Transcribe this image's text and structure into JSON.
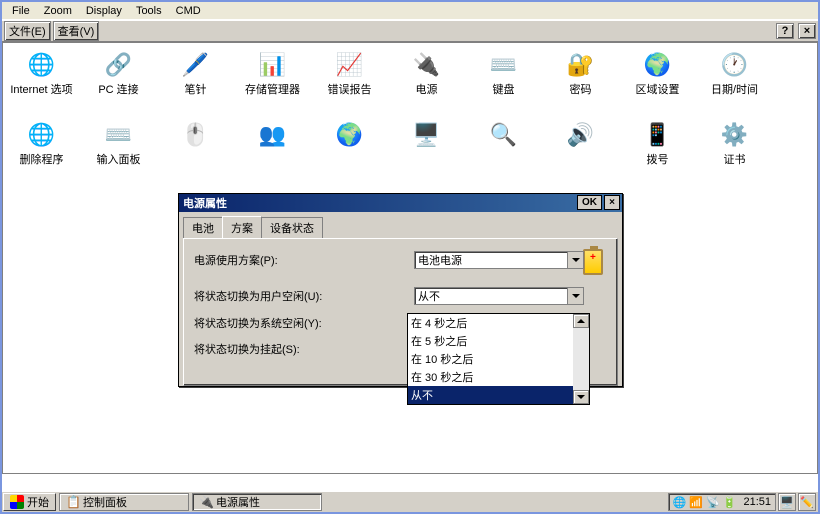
{
  "outer_menu": [
    "File",
    "Zoom",
    "Display",
    "Tools",
    "CMD"
  ],
  "inner_toolbar": {
    "file": "文件(E)",
    "view": "查看(V)",
    "help": "?",
    "close": "×"
  },
  "icons": [
    {
      "name": "internet-options",
      "label": "Internet 选项",
      "glyph": "🌐"
    },
    {
      "name": "pc-connection",
      "label": "PC 连接",
      "glyph": "🔗"
    },
    {
      "name": "stylus",
      "label": "笔针",
      "glyph": "🖊️"
    },
    {
      "name": "storage-manager",
      "label": "存储管理器",
      "glyph": "📊"
    },
    {
      "name": "error-reporting",
      "label": "错误报告",
      "glyph": "📈"
    },
    {
      "name": "power",
      "label": "电源",
      "glyph": "🔌"
    },
    {
      "name": "keyboard",
      "label": "键盘",
      "glyph": "⌨️"
    },
    {
      "name": "password",
      "label": "密码",
      "glyph": "🔐"
    },
    {
      "name": "regional-settings",
      "label": "区域设置",
      "glyph": "🌍"
    },
    {
      "name": "date-time",
      "label": "日期/时间",
      "glyph": "🕐"
    },
    {
      "name": "remove-programs",
      "label": "删除程序",
      "glyph": "🌐"
    },
    {
      "name": "input-panel",
      "label": "输入面板",
      "glyph": "⌨️"
    },
    {
      "name": "mouse",
      "label": "",
      "glyph": "🖱️"
    },
    {
      "name": "owner",
      "label": "",
      "glyph": "👥"
    },
    {
      "name": "network",
      "label": "",
      "glyph": "🌍"
    },
    {
      "name": "display",
      "label": "",
      "glyph": "🖥️"
    },
    {
      "name": "system",
      "label": "",
      "glyph": "🔍"
    },
    {
      "name": "audio",
      "label": "",
      "glyph": "🔊"
    },
    {
      "name": "dialup",
      "label": "拨号",
      "glyph": "📱"
    },
    {
      "name": "certificates",
      "label": "证书",
      "glyph": "⚙️"
    }
  ],
  "dialog": {
    "title": "电源属性",
    "ok": "OK",
    "close": "×",
    "tabs": [
      "电池",
      "方案",
      "设备状态"
    ],
    "active_tab": 1,
    "scheme_label": "电源使用方案(P):",
    "scheme_value": "电池电源",
    "user_idle_label": "将状态切换为用户空闲(U):",
    "user_idle_value": "从不",
    "sys_idle_label": "将状态切换为系统空闲(Y):",
    "suspend_label": "将状态切换为挂起(S):"
  },
  "dropdown_options": [
    "在 4 秒之后",
    "在 5 秒之后",
    "在 10 秒之后",
    "在 30 秒之后",
    "从不"
  ],
  "dropdown_selected": 4,
  "taskbar": {
    "start": "开始",
    "tasks": [
      {
        "label": "控制面板",
        "icon": "📋",
        "active": false
      },
      {
        "label": "电源属性",
        "icon": "🔌",
        "active": true
      }
    ],
    "clock": "21:51"
  }
}
